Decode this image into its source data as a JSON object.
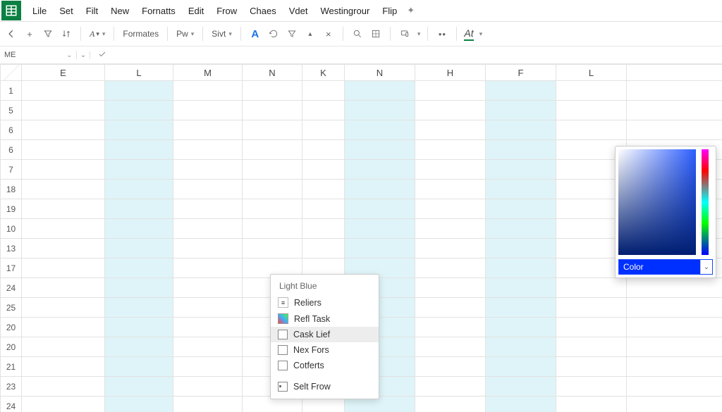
{
  "menu": {
    "items": [
      "Lile",
      "Set",
      "Filt",
      "New",
      "Fornatts",
      "Edit",
      "Frow",
      "Chaes",
      "Vdet",
      "Westingrour",
      "Flip"
    ]
  },
  "toolbar": {
    "formates_label": "Formates",
    "pw_label": "Pw",
    "size_label": "Sivt",
    "at_label": "At"
  },
  "namebox": {
    "value": "ME"
  },
  "columns": [
    "",
    "E",
    "L",
    "M",
    "N",
    "K",
    "N",
    "H",
    "F",
    "L"
  ],
  "rows": [
    "1",
    "5",
    "6",
    "6",
    "7",
    "18",
    "19",
    "10",
    "13",
    "17",
    "24",
    "25",
    "20",
    "20",
    "21",
    "23",
    "24"
  ],
  "highlight_cols": [
    2,
    6,
    8
  ],
  "context": {
    "title": "Light Blue",
    "items": [
      {
        "label": "Reliers",
        "icon": "list"
      },
      {
        "label": "Refl Task",
        "icon": "color"
      },
      {
        "label": "Cask Lief",
        "icon": "check",
        "hover": true
      },
      {
        "label": "Nex Fors",
        "icon": "check"
      },
      {
        "label": "Cotferts",
        "icon": "check"
      },
      {
        "label": "Selt Frow",
        "icon": "dot",
        "sep_before": true
      }
    ]
  },
  "color_picker": {
    "field_label": "Color"
  }
}
